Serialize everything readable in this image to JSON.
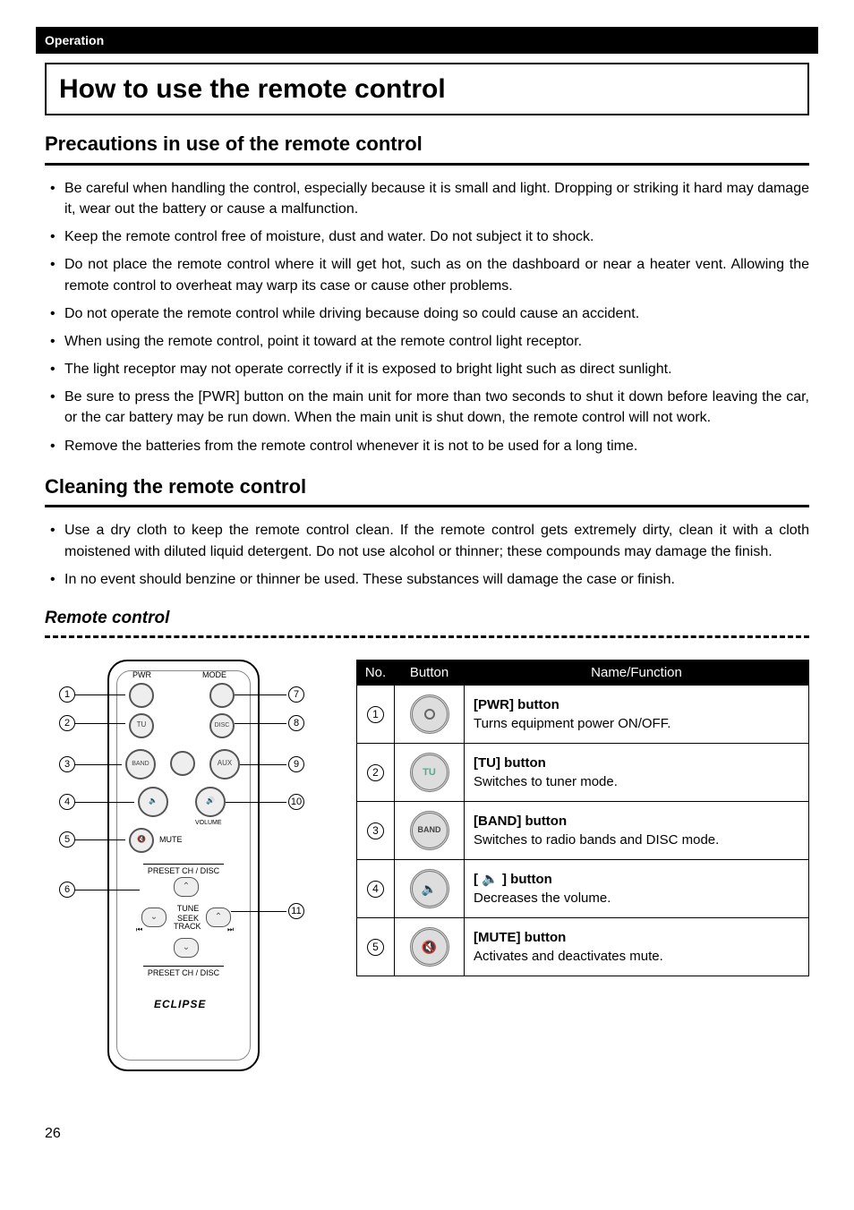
{
  "header": "Operation",
  "title": "How to use the remote control",
  "section1": {
    "heading": "Precautions in use of the remote control",
    "items": [
      "Be careful when handling the control, especially because it is small and light. Dropping or striking it hard may damage it, wear out the battery or cause a malfunction.",
      "Keep the remote control free of moisture, dust and water. Do not subject it to shock.",
      "Do not place the remote control where it will get hot, such as on the dashboard or near a heater vent. Allowing the remote control to overheat may warp its case or cause other problems.",
      "Do not operate the remote control while driving because doing so could cause an accident.",
      "When using the remote control, point it toward at the remote control light receptor.",
      "The light receptor may not operate correctly if it is exposed to bright light such as direct sunlight.",
      "Be sure to press the [PWR] button on the main unit for more than two seconds to shut it down before leaving the car, or the car battery may be run down. When the main unit is shut down, the remote control will not work.",
      "Remove the batteries from the remote control whenever it is not to be used for a long time."
    ]
  },
  "section2": {
    "heading": "Cleaning the remote control",
    "items": [
      "Use a dry cloth to keep the remote control clean. If the remote control gets extremely dirty, clean it with a cloth moistened with diluted liquid detergent. Do not use alcohol or thinner; these compounds may damage the finish.",
      "In no event should benzine or thinner be used. These substances will damage the case or finish."
    ]
  },
  "subsection_heading": "Remote control",
  "diagram": {
    "labels": {
      "pwr": "PWR",
      "mode": "MODE",
      "tu": "TU",
      "disc": "DISC",
      "band": "BAND",
      "aux": "AUX",
      "volume": "VOLUME",
      "mute": "MUTE",
      "preset_top": "PRESET CH / DISC",
      "tune_seek": "TUNE SEEK",
      "track": "TRACK",
      "preset_bottom": "PRESET CH / DISC",
      "brand": "ECLIPSE"
    },
    "callouts_left": [
      "1",
      "2",
      "3",
      "4",
      "5",
      "6"
    ],
    "callouts_right": [
      "7",
      "8",
      "9",
      "10",
      "11"
    ]
  },
  "table": {
    "headers": {
      "no": "No.",
      "button": "Button",
      "func": "Name/Function"
    },
    "rows": [
      {
        "no": "1",
        "btn_label": "",
        "name": "[PWR] button",
        "desc": "Turns equipment power ON/OFF."
      },
      {
        "no": "2",
        "btn_label": "TU",
        "name": "[TU] button",
        "desc": "Switches to tuner mode."
      },
      {
        "no": "3",
        "btn_label": "BAND",
        "name": "[BAND] button",
        "desc": "Switches to radio bands and DISC mode."
      },
      {
        "no": "4",
        "btn_label": "🔈",
        "name": "[ 🔈 ] button",
        "desc": "Decreases the volume."
      },
      {
        "no": "5",
        "btn_label": "🔇",
        "name": "[MUTE] button",
        "desc": "Activates and deactivates mute."
      }
    ]
  },
  "page_number": "26"
}
